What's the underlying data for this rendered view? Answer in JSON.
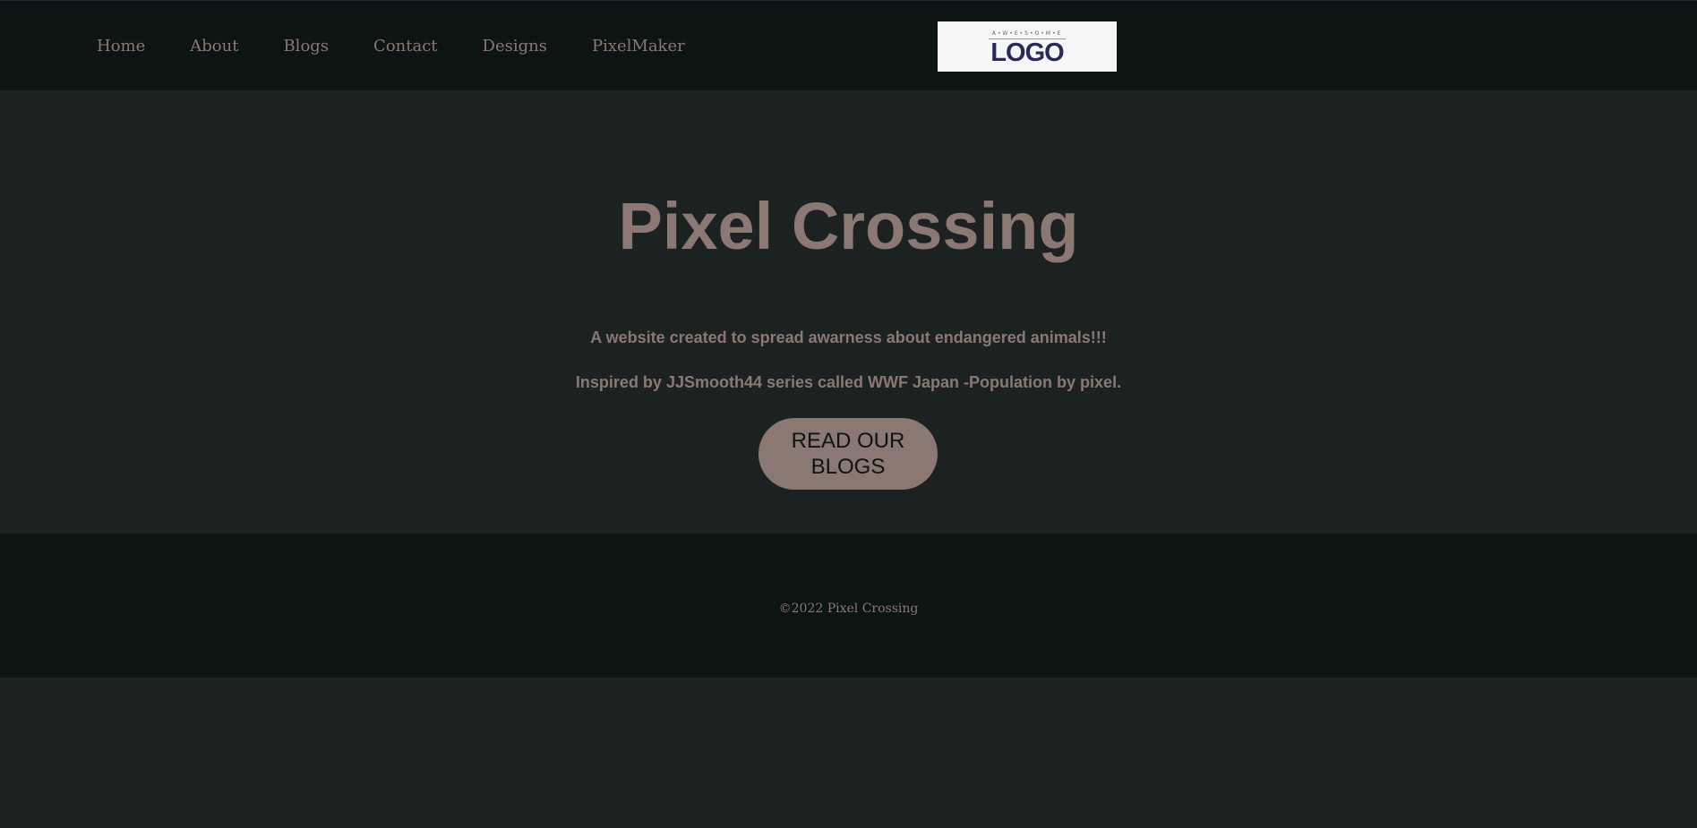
{
  "nav": {
    "items": [
      "Home",
      "About",
      "Blogs",
      "Contact",
      "Designs",
      "PixelMaker"
    ]
  },
  "logo": {
    "tagline": "A•W•E•S•O•M•E",
    "text": "LOGO"
  },
  "hero": {
    "title": "Pixel Crossing",
    "subtitle_1": "A website created to spread awarness about endangered animals!!!",
    "subtitle_2": "Inspired by JJSmooth44 series called WWF Japan -Population by pixel.",
    "cta_label": "READ OUR BLOGS"
  },
  "footer": {
    "copyright": "©2022 Pixel Crossing"
  },
  "colors": {
    "header_bg": "#0c1414",
    "page_bg": "#1c2222",
    "accent": "#8c7872",
    "logo_text": "#2a2a5a"
  }
}
